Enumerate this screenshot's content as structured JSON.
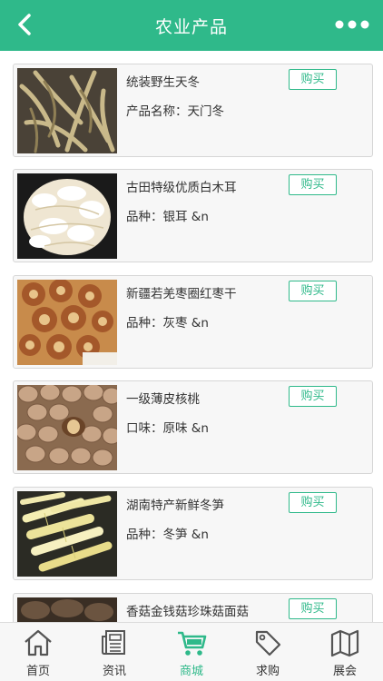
{
  "header": {
    "title": "农业产品"
  },
  "products": [
    {
      "name": "统装野生天冬",
      "spec": "产品名称：天门冬",
      "buy": "购买"
    },
    {
      "name": "古田特级优质白木耳",
      "spec": "品种：银耳 &n",
      "buy": "购买"
    },
    {
      "name": "新疆若羌枣圈红枣干",
      "spec": "品种：灰枣 &n",
      "buy": "购买"
    },
    {
      "name": "一级薄皮核桃",
      "spec": "口味：原味 &n",
      "buy": "购买"
    },
    {
      "name": "湖南特产新鲜冬笋",
      "spec": "品种：冬笋 &n",
      "buy": "购买"
    },
    {
      "name": "香菇金钱菇珍珠菇面菇",
      "spec": "",
      "buy": "购买"
    }
  ],
  "tabs": [
    {
      "label": "首页",
      "icon": "home-icon"
    },
    {
      "label": "资讯",
      "icon": "news-icon"
    },
    {
      "label": "商城",
      "icon": "cart-icon",
      "active": true
    },
    {
      "label": "求购",
      "icon": "tag-icon"
    },
    {
      "label": "展会",
      "icon": "map-icon"
    }
  ],
  "colors": {
    "accent": "#2fb98a"
  }
}
